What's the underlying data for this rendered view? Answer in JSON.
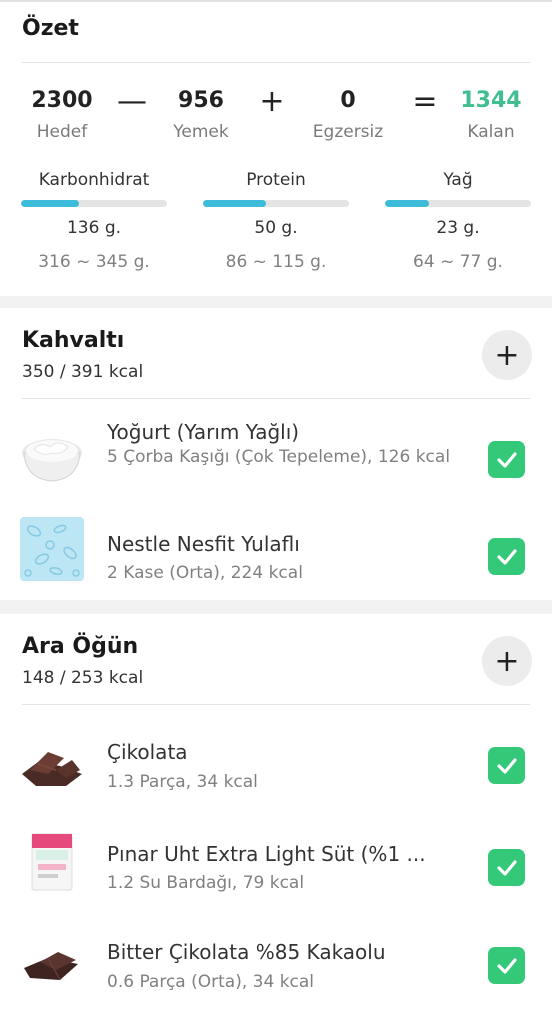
{
  "summary": {
    "title": "Özet",
    "goal": {
      "value": "2300",
      "label": "Hedef"
    },
    "food": {
      "value": "956",
      "label": "Yemek"
    },
    "exercise": {
      "value": "0",
      "label": "Egzersiz"
    },
    "remaining": {
      "value": "1344",
      "label": "Kalan"
    },
    "ops": {
      "minus": "—",
      "plus": "+",
      "equals": "="
    },
    "colors": {
      "remaining": "#3fbf8f",
      "bar_fill": "#3cbcd8",
      "check": "#34c879"
    },
    "macros": [
      {
        "label": "Karbonhidrat",
        "value": "136 g.",
        "range": "316 ~ 345 g.",
        "progress": 0.4
      },
      {
        "label": "Protein",
        "value": "50 g.",
        "range": "86 ~ 115 g.",
        "progress": 0.43
      },
      {
        "label": "Yağ",
        "value": "23 g.",
        "range": "64 ~ 77 g.",
        "progress": 0.3
      }
    ]
  },
  "meals": [
    {
      "title": "Kahvaltı",
      "kcal": "350 / 391 kcal",
      "add_icon": "plus-icon",
      "items": [
        {
          "name": "Yoğurt (Yarım Yağlı)",
          "detail": "5 Çorba Kaşığı (Çok Tepeleme), 126 kcal",
          "icon": "yogurt-bowl-icon",
          "checked": true
        },
        {
          "name": "Nestle Nesfit Yulaflı",
          "detail": "2 Kase (Orta), 224 kcal",
          "icon": "cereal-pattern-icon",
          "checked": true
        }
      ]
    },
    {
      "title": "Ara Öğün",
      "kcal": "148 / 253 kcal",
      "add_icon": "plus-icon",
      "items": [
        {
          "name": "Çikolata",
          "detail": "1.3 Parça, 34 kcal",
          "icon": "chocolate-icon",
          "checked": true
        },
        {
          "name": "Pınar Uht Extra Light Süt (%1 ...",
          "detail": "1.2 Su Bardağı, 79 kcal",
          "icon": "milk-carton-icon",
          "checked": true
        },
        {
          "name": "Bitter Çikolata %85 Kakaolu",
          "detail": "0.6 Parça (Orta), 34 kcal",
          "icon": "dark-chocolate-icon",
          "checked": true
        }
      ]
    }
  ]
}
